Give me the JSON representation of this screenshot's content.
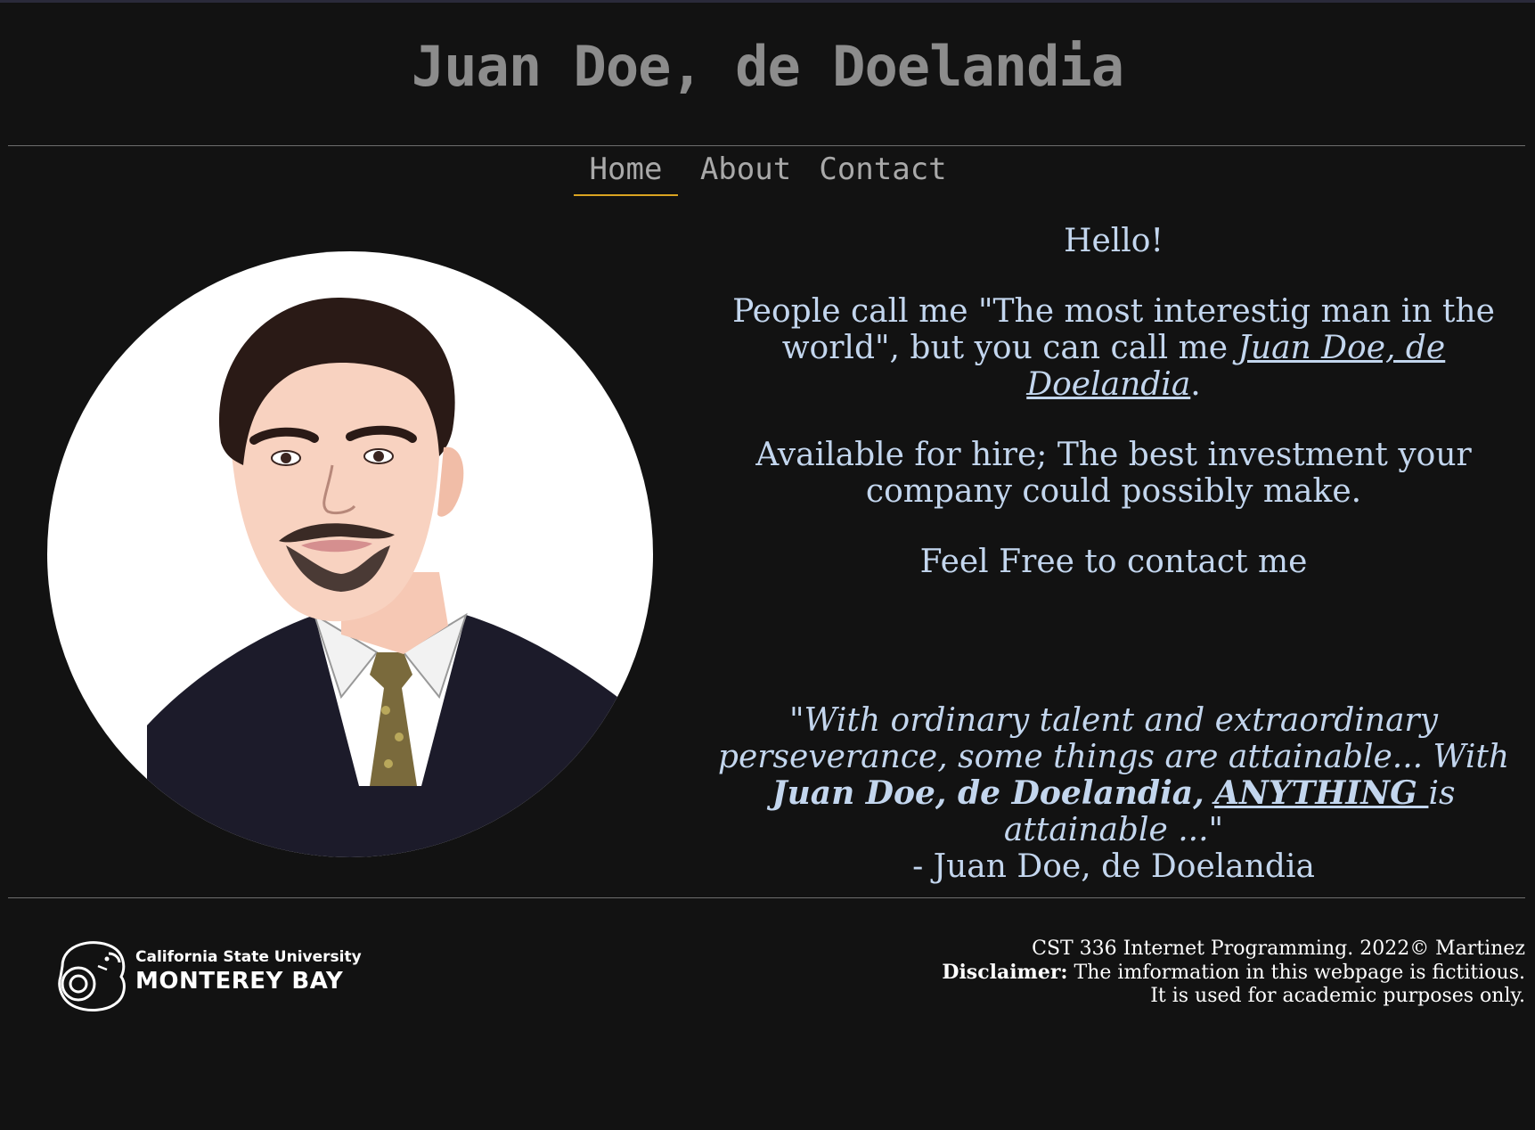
{
  "header": {
    "title": "Juan Doe, de Doelandia"
  },
  "nav": {
    "items": [
      {
        "label": "Home"
      },
      {
        "label": "About"
      },
      {
        "label": "Contact"
      }
    ]
  },
  "intro": {
    "greeting": "Hello!",
    "call_before": "People call me \"The most interestig man in the world\", but you can call me ",
    "call_link": "Juan Doe, de Doelandia",
    "call_after": ".",
    "hire": "Available for hire; The best investment your company could possibly make.",
    "contact": "Feel Free to contact me"
  },
  "quote": {
    "part1": "\"With ordinary talent and extraordinary perseverance, some things are attainable... With ",
    "name": "Juan Doe, de Doelandia,",
    "space": " ",
    "anything": "ANYTHING ",
    "part2": "is attainable ...\"",
    "attribution": "- Juan Doe, de Doelandia"
  },
  "footer": {
    "logo_line1": "California State University",
    "logo_line2": "MONTEREY BAY",
    "course": "CST 336 Internet Programming. 2022© Martinez",
    "disclaimer_label": "Disclaimer:",
    "disclaimer_text": " The imformation in this webpage is fictitious.",
    "disclaimer_line2": "It is used for academic purposes only."
  },
  "colors": {
    "background": "#121212",
    "text": "#c3d6ee",
    "title": "#8c8c8c",
    "nav_active_underline": "#d9a321"
  },
  "icons": {
    "logo": "csumb-otter-logo",
    "portrait": "cartoon-portrait"
  }
}
